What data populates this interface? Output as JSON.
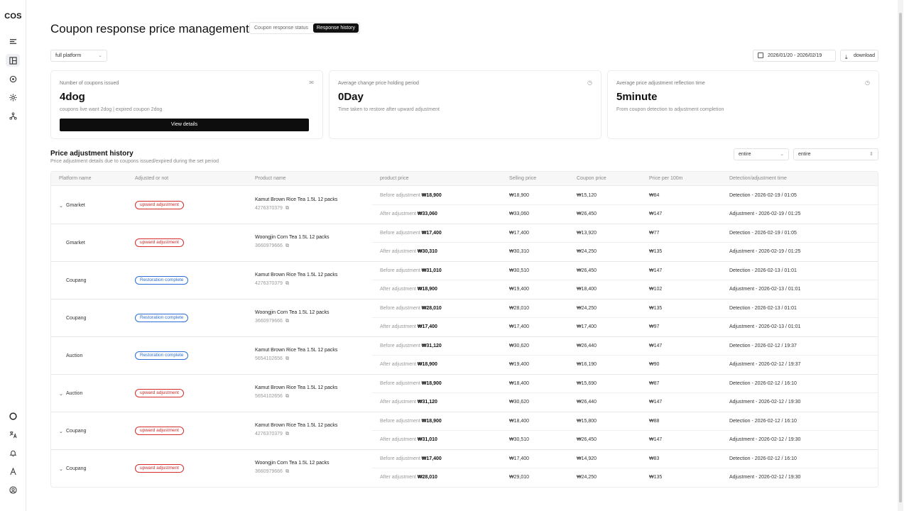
{
  "app": {
    "logo": "COS"
  },
  "page": {
    "title": "Coupon response price management"
  },
  "tabs": [
    {
      "label": "Coupon response status",
      "active": false
    },
    {
      "label": "Response history",
      "active": true
    }
  ],
  "filters": {
    "platform": "full platform",
    "date_range": "2026/01/20 - 2026/02/19",
    "download": "download",
    "status_filter": "entire",
    "type_filter": "entire"
  },
  "cards": [
    {
      "label": "Number of coupons issued",
      "value": "4dog",
      "sub": "coupons live want 2dog | expired coupon 2dog",
      "button": "View details",
      "icon": "mail-icon"
    },
    {
      "label": "Average change price holding period",
      "value": "0Day",
      "sub": "Time taken to restore after upward adjustment",
      "icon": "clock-icon"
    },
    {
      "label": "Average price adjustment reflection time",
      "value": "5minute",
      "sub": "From coupon detection to adjustment completion",
      "icon": "clock-icon"
    }
  ],
  "history": {
    "title": "Price adjustment history",
    "subtitle": "Price adjustment details due to coupons issued/expired during the set period",
    "columns": [
      "Platform name",
      "Adjusted or not",
      "Product name",
      "product price",
      "Selling price",
      "Coupon price",
      "Price per 100m",
      "Detection/adjustment time"
    ],
    "groups": [
      {
        "platform": "Gmarket",
        "expand": true,
        "status": "upward adjustment",
        "status_type": "up",
        "product": "Kamut Brown Rice Tea 1.5L 12 packs",
        "product_id": "4276370379",
        "rows": [
          {
            "label": "Before adjustment",
            "price": "₩18,900",
            "selling": "₩18,900",
            "coupon": "₩15,120",
            "per100": "₩84",
            "time": "Detection - 2026-02-19 / 01:05"
          },
          {
            "label": "After adjustment",
            "price": "₩33,060",
            "selling": "₩33,060",
            "coupon": "₩26,450",
            "per100": "₩147",
            "time": "Adjustment - 2026-02-19 / 01:25"
          }
        ]
      },
      {
        "platform": "Gmarket",
        "expand": false,
        "status": "upward adjustment",
        "status_type": "up",
        "product": "Woongjin Corn Tea 1.5L 12 packs",
        "product_id": "3660979666",
        "rows": [
          {
            "label": "Before adjustment",
            "price": "₩17,400",
            "selling": "₩17,400",
            "coupon": "₩13,920",
            "per100": "₩77",
            "time": "Detection - 2026-02-19 / 01:05"
          },
          {
            "label": "After adjustment",
            "price": "₩30,310",
            "selling": "₩30,310",
            "coupon": "₩24,250",
            "per100": "₩135",
            "time": "Adjustment - 2026-02-19 / 01:25"
          }
        ]
      },
      {
        "platform": "Coupang",
        "expand": false,
        "status": "Restoration complete",
        "status_type": "done",
        "product": "Kamut Brown Rice Tea 1.5L 12 packs",
        "product_id": "4276370379",
        "rows": [
          {
            "label": "Before adjustment",
            "price": "₩31,010",
            "selling": "₩30,510",
            "coupon": "₩26,450",
            "per100": "₩147",
            "time": "Detection - 2026-02-13 / 01:01"
          },
          {
            "label": "After adjustment",
            "price": "₩18,900",
            "selling": "₩19,400",
            "coupon": "₩18,400",
            "per100": "₩102",
            "time": "Adjustment - 2026-02-13 / 01:01"
          }
        ]
      },
      {
        "platform": "Coupang",
        "expand": false,
        "status": "Restoration complete",
        "status_type": "done",
        "product": "Woongjin Corn Tea 1.5L 12 packs",
        "product_id": "3660979666",
        "rows": [
          {
            "label": "Before adjustment",
            "price": "₩28,010",
            "selling": "₩28,010",
            "coupon": "₩24,250",
            "per100": "₩135",
            "time": "Detection - 2026-02-13 / 01:01"
          },
          {
            "label": "After adjustment",
            "price": "₩17,400",
            "selling": "₩17,400",
            "coupon": "₩17,400",
            "per100": "₩97",
            "time": "Adjustment - 2026-02-13 / 01:01"
          }
        ]
      },
      {
        "platform": "Auction",
        "expand": false,
        "status": "Restoration complete",
        "status_type": "done",
        "product": "Kamut Brown Rice Tea 1.5L 12 packs",
        "product_id": "5654102656",
        "rows": [
          {
            "label": "Before adjustment",
            "price": "₩31,120",
            "selling": "₩30,620",
            "coupon": "₩26,440",
            "per100": "₩147",
            "time": "Detection - 2026-02-12 / 19:37"
          },
          {
            "label": "After adjustment",
            "price": "₩18,900",
            "selling": "₩19,400",
            "coupon": "₩16,190",
            "per100": "₩90",
            "time": "Adjustment - 2026-02-12 / 19:37"
          }
        ]
      },
      {
        "platform": "Auction",
        "expand": true,
        "status": "upward adjustment",
        "status_type": "up",
        "product": "Kamut Brown Rice Tea 1.5L 12 packs",
        "product_id": "5654102656",
        "rows": [
          {
            "label": "Before adjustment",
            "price": "₩18,900",
            "selling": "₩18,400",
            "coupon": "₩15,690",
            "per100": "₩87",
            "time": "Detection - 2026-02-12 / 16:10"
          },
          {
            "label": "After adjustment",
            "price": "₩31,120",
            "selling": "₩30,620",
            "coupon": "₩26,440",
            "per100": "₩147",
            "time": "Adjustment - 2026-02-12 / 19:30"
          }
        ]
      },
      {
        "platform": "Coupang",
        "expand": true,
        "status": "upward adjustment",
        "status_type": "up",
        "product": "Kamut Brown Rice Tea 1.5L 12 packs",
        "product_id": "4276370379",
        "rows": [
          {
            "label": "Before adjustment",
            "price": "₩18,900",
            "selling": "₩18,400",
            "coupon": "₩15,800",
            "per100": "₩88",
            "time": "Detection - 2026-02-12 / 16:10"
          },
          {
            "label": "After adjustment",
            "price": "₩31,010",
            "selling": "₩30,510",
            "coupon": "₩26,450",
            "per100": "₩147",
            "time": "Adjustment - 2026-02-12 / 19:30"
          }
        ]
      },
      {
        "platform": "Coupang",
        "expand": true,
        "status": "upward adjustment",
        "status_type": "up",
        "product": "Woongjin Corn Tea 1.5L 12 packs",
        "product_id": "3660979666",
        "rows": [
          {
            "label": "Before adjustment",
            "price": "₩17,400",
            "selling": "₩17,400",
            "coupon": "₩14,920",
            "per100": "₩83",
            "time": "Detection - 2026-02-12 / 16:10"
          },
          {
            "label": "After adjustment",
            "price": "₩28,010",
            "selling": "₩29,010",
            "coupon": "₩24,250",
            "per100": "₩135",
            "time": "Adjustment - 2026-02-12 / 19:30"
          }
        ]
      }
    ]
  },
  "colors": {
    "upward": "#d62b2b",
    "restored": "#2b6fd6",
    "accent": "#111111"
  }
}
